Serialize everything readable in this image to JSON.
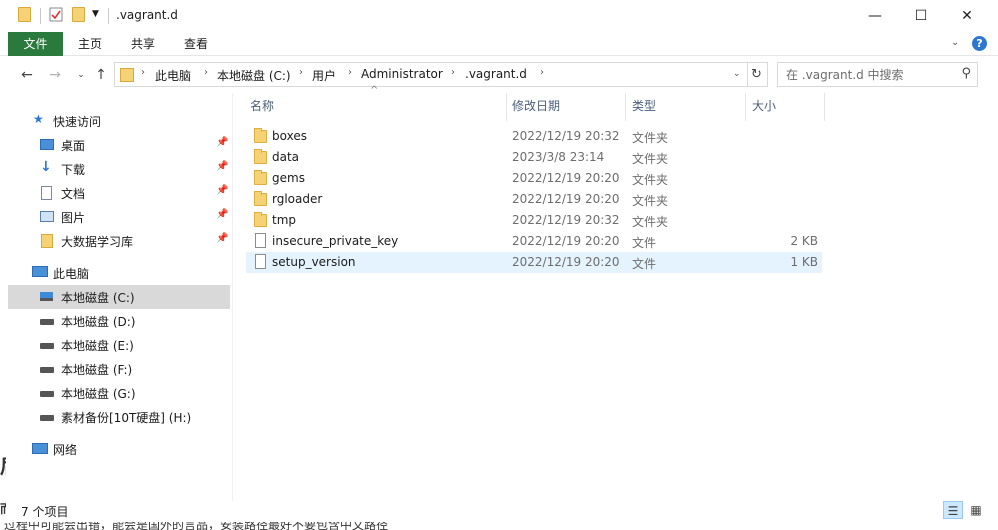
{
  "window": {
    "title": ".vagrant.d",
    "controls": {
      "minimize": "—",
      "maximize": "☐",
      "close": "✕"
    }
  },
  "ribbon": {
    "tabs": [
      "文件",
      "主页",
      "共享",
      "查看"
    ],
    "expand_icon": "chevron-down-icon",
    "help_label": "?"
  },
  "nav": {
    "breadcrumbs": [
      "此电脑",
      "本地磁盘 (C:)",
      "用户",
      "Administrator",
      ".vagrant.d"
    ],
    "search_placeholder": "在 .vagrant.d 中搜索"
  },
  "sidebar": {
    "items": [
      {
        "label": "快速访问",
        "icon": "star-icon",
        "indent": 0
      },
      {
        "label": "桌面",
        "icon": "desktop-icon",
        "indent": 1,
        "pinned": true
      },
      {
        "label": "下载",
        "icon": "download-icon",
        "indent": 1,
        "pinned": true
      },
      {
        "label": "文档",
        "icon": "document-icon",
        "indent": 1,
        "pinned": true
      },
      {
        "label": "图片",
        "icon": "pictures-icon",
        "indent": 1,
        "pinned": true
      },
      {
        "label": "大数据学习库",
        "icon": "folder-icon",
        "indent": 1,
        "pinned": true
      },
      {
        "label": "此电脑",
        "icon": "computer-icon",
        "indent": 0
      },
      {
        "label": "本地磁盘 (C:)",
        "icon": "windows-drive-icon",
        "indent": 1,
        "selected": true
      },
      {
        "label": "本地磁盘 (D:)",
        "icon": "drive-icon",
        "indent": 1
      },
      {
        "label": "本地磁盘 (E:)",
        "icon": "drive-icon",
        "indent": 1
      },
      {
        "label": "本地磁盘 (F:)",
        "icon": "drive-icon",
        "indent": 1
      },
      {
        "label": "本地磁盘 (G:)",
        "icon": "drive-icon",
        "indent": 1
      },
      {
        "label": "素材备份[10T硬盘] (H:)",
        "icon": "drive-icon",
        "indent": 1
      },
      {
        "label": "网络",
        "icon": "network-icon",
        "indent": 0
      }
    ]
  },
  "filelist": {
    "columns": [
      "名称",
      "修改日期",
      "类型",
      "大小"
    ],
    "rows": [
      {
        "name": "boxes",
        "date": "2022/12/19 20:32",
        "type": "文件夹",
        "size": "",
        "kind": "folder"
      },
      {
        "name": "data",
        "date": "2023/3/8 23:14",
        "type": "文件夹",
        "size": "",
        "kind": "folder"
      },
      {
        "name": "gems",
        "date": "2022/12/19 20:20",
        "type": "文件夹",
        "size": "",
        "kind": "folder"
      },
      {
        "name": "rgloader",
        "date": "2022/12/19 20:20",
        "type": "文件夹",
        "size": "",
        "kind": "folder"
      },
      {
        "name": "tmp",
        "date": "2022/12/19 20:32",
        "type": "文件夹",
        "size": "",
        "kind": "folder"
      },
      {
        "name": "insecure_private_key",
        "date": "2022/12/19 20:20",
        "type": "文件",
        "size": "2 KB",
        "kind": "file"
      },
      {
        "name": "setup_version",
        "date": "2022/12/19 20:20",
        "type": "文件",
        "size": "1 KB",
        "kind": "file",
        "selected": true
      }
    ]
  },
  "status": {
    "item_count": "7 个项目"
  },
  "background": {
    "text": "过程中可能会出错，能会是国外的言品，安装路径最好不要包含中文路径",
    "edge_char_1": "后",
    "edge_char_2": "而"
  },
  "colors": {
    "file_tab": "#2b7a3d",
    "selection": "#e5f3ff",
    "sidebar_selection": "#d9d9d9",
    "folder": "#f6d277"
  }
}
